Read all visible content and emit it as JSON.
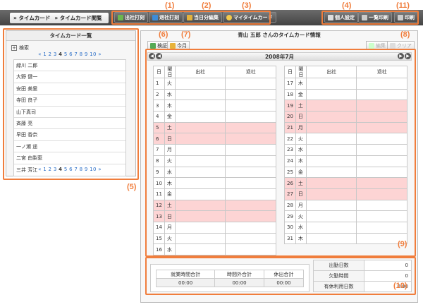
{
  "nav": {
    "breadcrumb_1": "タイムカード",
    "breadcrumb_2": "タイムカード閲覧",
    "buttons": [
      "出社打刻",
      "退社打刻",
      "当日分編集",
      "マイタイムカード",
      "個人設定",
      "一覧印刷",
      "印刷"
    ]
  },
  "annotations": [
    "(1)",
    "(2)",
    "(3)",
    "(4)",
    "(5)",
    "(6)",
    "(7)",
    "(8)",
    "(9)",
    "(10)",
    "(11)"
  ],
  "list": {
    "title": "タイムカード一覧",
    "search_label": "検索",
    "pager_prefix": "« 1 2 3",
    "pager_current": "4",
    "pager_suffix": "5 6 7 8 9 10 »",
    "names": [
      "緑川 二郎",
      "大野 健一",
      "安田 美里",
      "寺田 良子",
      "山下真司",
      "斉藤 亮",
      "早田 香奈",
      "一ノ瀬 遥",
      "二宮 由梨恵",
      "三井 芳江"
    ]
  },
  "main": {
    "title": "青山 五郎 さんのタイムカード情報",
    "verify_label": "検証",
    "thismonth_label": "今月",
    "edit_label": "編集",
    "clear_label": "クリア",
    "month_label": "2008年7月",
    "prev_icon": "double-chevron-left",
    "next_icon": "double-chevron-right",
    "headers": {
      "day": "日",
      "weekday": "曜日",
      "in": "出社",
      "out": "退社"
    },
    "weekend_color": "#fdd4d4",
    "accent_color": "#f07d3c",
    "left_days": [
      {
        "d": "1",
        "w": "火",
        "we": false
      },
      {
        "d": "2",
        "w": "水",
        "we": false
      },
      {
        "d": "3",
        "w": "木",
        "we": false
      },
      {
        "d": "4",
        "w": "金",
        "we": false
      },
      {
        "d": "5",
        "w": "土",
        "we": true
      },
      {
        "d": "6",
        "w": "日",
        "we": true
      },
      {
        "d": "7",
        "w": "月",
        "we": false
      },
      {
        "d": "8",
        "w": "火",
        "we": false
      },
      {
        "d": "9",
        "w": "水",
        "we": false
      },
      {
        "d": "10",
        "w": "木",
        "we": false
      },
      {
        "d": "11",
        "w": "金",
        "we": false
      },
      {
        "d": "12",
        "w": "土",
        "we": true
      },
      {
        "d": "13",
        "w": "日",
        "we": true
      },
      {
        "d": "14",
        "w": "月",
        "we": false
      },
      {
        "d": "15",
        "w": "火",
        "we": false
      },
      {
        "d": "16",
        "w": "水",
        "we": false
      }
    ],
    "right_days": [
      {
        "d": "17",
        "w": "木",
        "we": false
      },
      {
        "d": "18",
        "w": "金",
        "we": false
      },
      {
        "d": "19",
        "w": "土",
        "we": true
      },
      {
        "d": "20",
        "w": "日",
        "we": true
      },
      {
        "d": "21",
        "w": "月",
        "we": true
      },
      {
        "d": "22",
        "w": "火",
        "we": false
      },
      {
        "d": "23",
        "w": "水",
        "we": false
      },
      {
        "d": "24",
        "w": "木",
        "we": false
      },
      {
        "d": "25",
        "w": "金",
        "we": false
      },
      {
        "d": "26",
        "w": "土",
        "we": true
      },
      {
        "d": "27",
        "w": "日",
        "we": true
      },
      {
        "d": "28",
        "w": "月",
        "we": false
      },
      {
        "d": "29",
        "w": "火",
        "we": false
      },
      {
        "d": "30",
        "w": "水",
        "we": false
      },
      {
        "d": "31",
        "w": "木",
        "we": false
      }
    ]
  },
  "totals": {
    "headers": [
      "就業時間合計",
      "時間外合計",
      "休出合計"
    ],
    "values": [
      "00:00",
      "00:00",
      "00:00"
    ]
  },
  "stats": [
    {
      "label": "出勤日数",
      "value": "0"
    },
    {
      "label": "欠勤時間",
      "value": "0"
    },
    {
      "label": "有休利用日数",
      "value": "0.00"
    }
  ]
}
